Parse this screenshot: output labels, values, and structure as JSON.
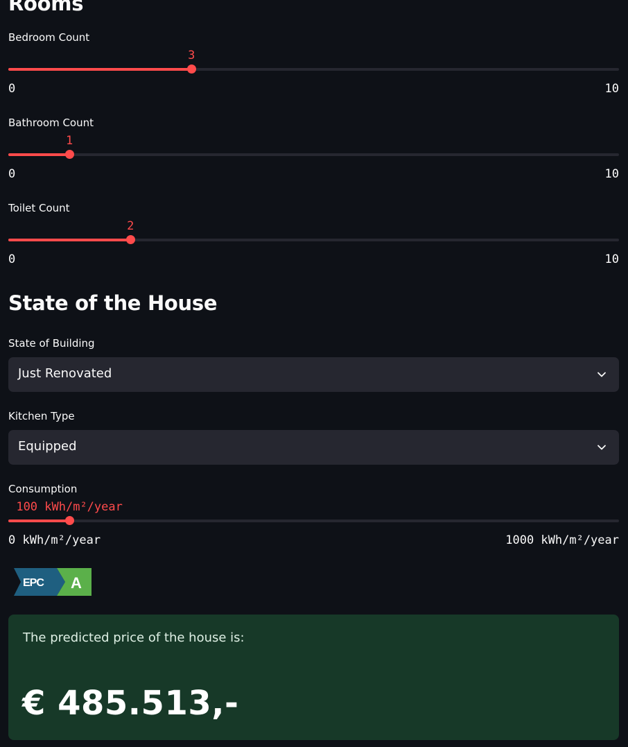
{
  "sections": {
    "rooms_title": "Rooms",
    "state_title": "State of the House"
  },
  "sliders": {
    "bedroom": {
      "label": "Bedroom Count",
      "value": 3,
      "value_text": "3",
      "min": 0,
      "max": 10,
      "min_text": "0",
      "max_text": "10"
    },
    "bathroom": {
      "label": "Bathroom Count",
      "value": 1,
      "value_text": "1",
      "min": 0,
      "max": 10,
      "min_text": "0",
      "max_text": "10"
    },
    "toilet": {
      "label": "Toilet Count",
      "value": 2,
      "value_text": "2",
      "min": 0,
      "max": 10,
      "min_text": "0",
      "max_text": "10"
    },
    "consumption": {
      "label": "Consumption",
      "value": 100,
      "value_text": "100 kWh/m²/year",
      "min": 0,
      "max": 1000,
      "min_text": "0 kWh/m²/year",
      "max_text": "1000 kWh/m²/year"
    }
  },
  "selects": {
    "state_of_building": {
      "label": "State of Building",
      "value": "Just Renovated"
    },
    "kitchen_type": {
      "label": "Kitchen Type",
      "value": "Equipped"
    }
  },
  "epc_badge": {
    "prefix": "EPC",
    "rating": "A",
    "colors": {
      "prefix_bg": "#1f5f80",
      "rating_bg": "#5bb04a"
    }
  },
  "result": {
    "label": "The predicted price of the house is:",
    "price": "€ 485.513,-"
  },
  "colors": {
    "accent": "#ff4b4b",
    "background": "#0e1117",
    "input_bg": "#262730",
    "success_bg": "#173928"
  }
}
